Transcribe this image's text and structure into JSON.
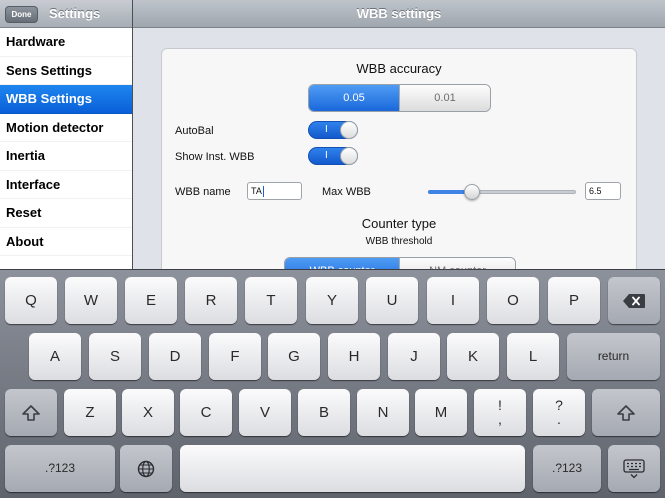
{
  "master": {
    "done_label": "Done",
    "title": "Settings",
    "items": [
      {
        "label": "Hardware",
        "selected": false
      },
      {
        "label": "Sens Settings",
        "selected": false
      },
      {
        "label": "WBB Settings",
        "selected": true
      },
      {
        "label": "Motion detector",
        "selected": false
      },
      {
        "label": "Inertia",
        "selected": false
      },
      {
        "label": "Interface",
        "selected": false
      },
      {
        "label": "Reset",
        "selected": false
      },
      {
        "label": "About",
        "selected": false
      }
    ]
  },
  "detail": {
    "title": "WBB settings",
    "accuracy": {
      "title": "WBB accuracy",
      "options": [
        "0.05",
        "0.01"
      ],
      "selected": "0.05"
    },
    "autobal": {
      "label": "AutoBal",
      "on": true,
      "mark": "I"
    },
    "show_inst": {
      "label": "Show Inst. WBB",
      "on": true,
      "mark": "I"
    },
    "wbb_name": {
      "label": "WBB name",
      "value": "TA"
    },
    "max_wbb": {
      "label": "Max WBB",
      "value": "6.5",
      "slider_fraction": 0.3
    },
    "counter_type": {
      "title": "Counter type",
      "subtitle": "WBB threshold",
      "options": [
        "WBB counter",
        "NM counter"
      ],
      "selected": "WBB counter"
    }
  },
  "keyboard": {
    "row1": [
      "Q",
      "W",
      "E",
      "R",
      "T",
      "Y",
      "U",
      "I",
      "O",
      "P"
    ],
    "row2": [
      "A",
      "S",
      "D",
      "F",
      "G",
      "H",
      "J",
      "K",
      "L"
    ],
    "row3": [
      "Z",
      "X",
      "C",
      "V",
      "B",
      "N",
      "M"
    ],
    "return_label": "return",
    "punct1": [
      "!",
      ","
    ],
    "punct2": [
      "?",
      "."
    ],
    "numbers_label": ".?123",
    "icons": [
      "delete-icon",
      "shift-icon",
      "globe-icon",
      "keyboard-dismiss-icon"
    ]
  }
}
